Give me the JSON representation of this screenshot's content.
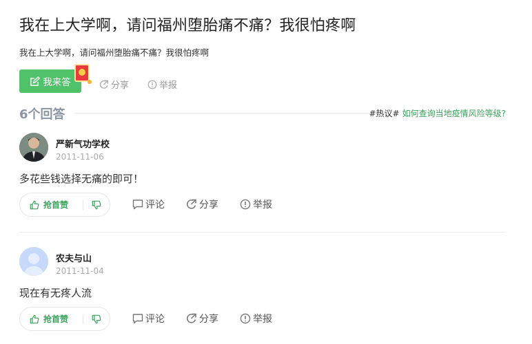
{
  "question": {
    "title": "我在上大学啊，请问福州堕胎痛不痛？我很怕疼啊",
    "description": "我在上大学啊，请问福州堕胎痛不痛？我很怕疼啊",
    "answer_button": "我来答",
    "share_label": "分享",
    "report_label": "举报"
  },
  "answers_header": {
    "count_label": "6个回答",
    "hot_tag": "#热议#",
    "hot_link": "如何查询当地疫情风险等级?"
  },
  "answers": [
    {
      "username": "严新气功学校",
      "date": "2011-11-06",
      "content": "多花些钱选择无痛的即可！",
      "upvote_label": "抢首赞",
      "comment_label": "评论",
      "share_label": "分享",
      "report_label": "举报"
    },
    {
      "username": "农夫与山",
      "date": "2011-11-04",
      "content": "现在有无疼人流",
      "upvote_label": "抢首赞",
      "comment_label": "评论",
      "share_label": "分享",
      "report_label": "举报"
    }
  ],
  "colors": {
    "accent_green": "#4fc26a",
    "link_green": "#3aa25b",
    "count_gray": "#8b95a3"
  },
  "icons": {
    "answer_button": "edit-icon",
    "share": "share-icon",
    "report": "report-icon",
    "comment": "comment-icon",
    "upvote": "thumbs-up-icon",
    "downvote": "thumbs-down-icon",
    "red_packet": "red-packet-icon"
  }
}
